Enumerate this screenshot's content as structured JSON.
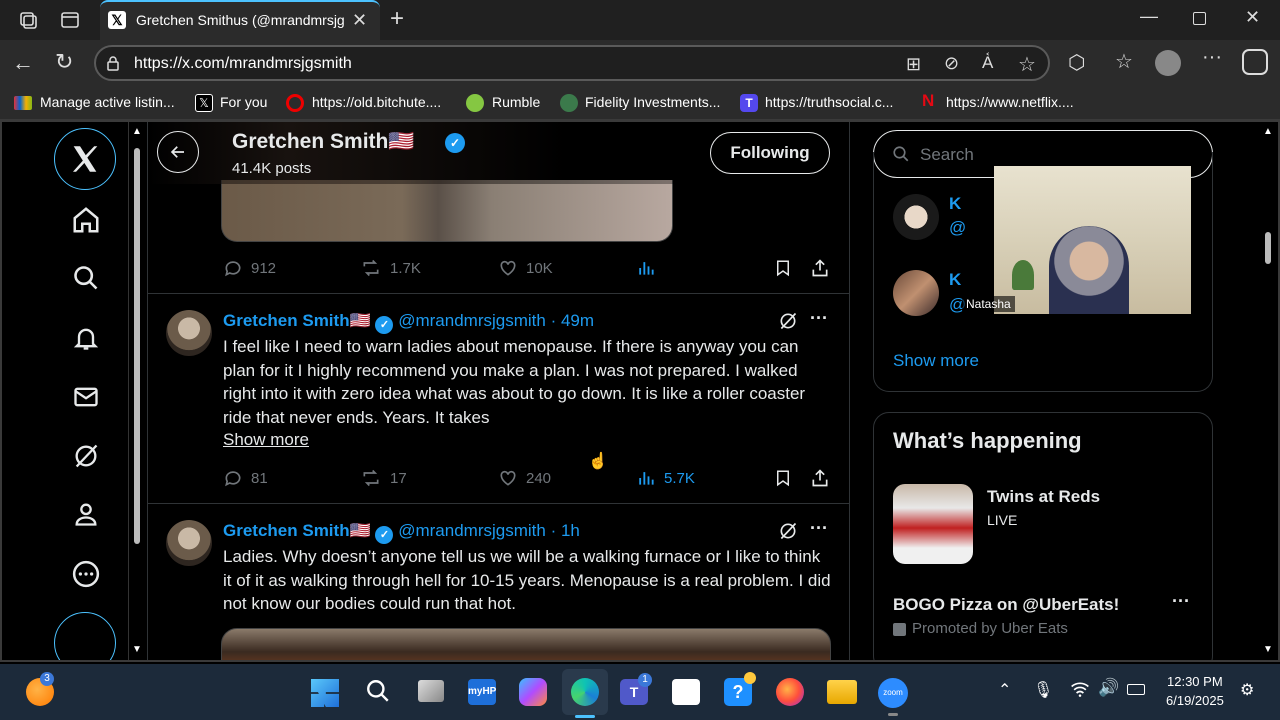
{
  "browser": {
    "tab_title": "Gretchen Smithus (@mrandmrsjg",
    "url": "https://x.com/mrandmrsjgsmith",
    "bookmarks": [
      "Manage active listin...",
      "For you",
      "https://old.bitchute....",
      "Rumble",
      "Fidelity Investments...",
      "https://truthsocial.c...",
      "https://www.netflix...."
    ]
  },
  "header": {
    "name": "Gretchen Smith🇺🇸",
    "post_count": "41.4K posts",
    "following_button": "Following"
  },
  "prev_post_metrics": {
    "replies": "912",
    "reposts": "1.7K",
    "likes": "10K"
  },
  "posts": [
    {
      "name": "Gretchen Smith🇺🇸",
      "handle": "@mrandmrsjgsmith",
      "time": "· 49m",
      "text": "I feel like I need to warn ladies about menopause. If there is anyway you can plan for it I highly recommend you make a plan. I was not prepared. I walked right into it with zero idea what was about to go down. It is like a roller coaster ride that never ends. Years. It takes",
      "show_more": "Show more",
      "replies": "81",
      "reposts": "17",
      "likes": "240",
      "views": "5.7K"
    },
    {
      "name": "Gretchen Smith🇺🇸",
      "handle": "@mrandmrsjgsmith",
      "time": "· 1h",
      "text": "Ladies. Why doesn’t anyone tell us we will be a walking furnace or I like to think it of it as walking through hell for 10-15 years. Menopause is  a real problem. I did not know our bodies could run that hot."
    }
  ],
  "sidebar": {
    "search_placeholder": "Search",
    "who_to_follow": [
      {
        "initial": "K",
        "handle": "@"
      },
      {
        "initial": "K",
        "handle": "@"
      }
    ],
    "show_more": "Show more",
    "whats_happening_title": "What’s happening",
    "trend_title": "Twins at Reds",
    "trend_status": "LIVE",
    "promo_title": "BOGO Pizza on @UberEats!",
    "promo_by": "Promoted by Uber Eats"
  },
  "video_overlay": {
    "name_label": "Natasha"
  },
  "taskbar": {
    "time": "12:30 PM",
    "date": "6/19/2025",
    "badge_widget": "3",
    "badge_teams": "1"
  },
  "colors": {
    "accent": "#1d9bf0",
    "edge_accent": "#4cc2ff"
  }
}
